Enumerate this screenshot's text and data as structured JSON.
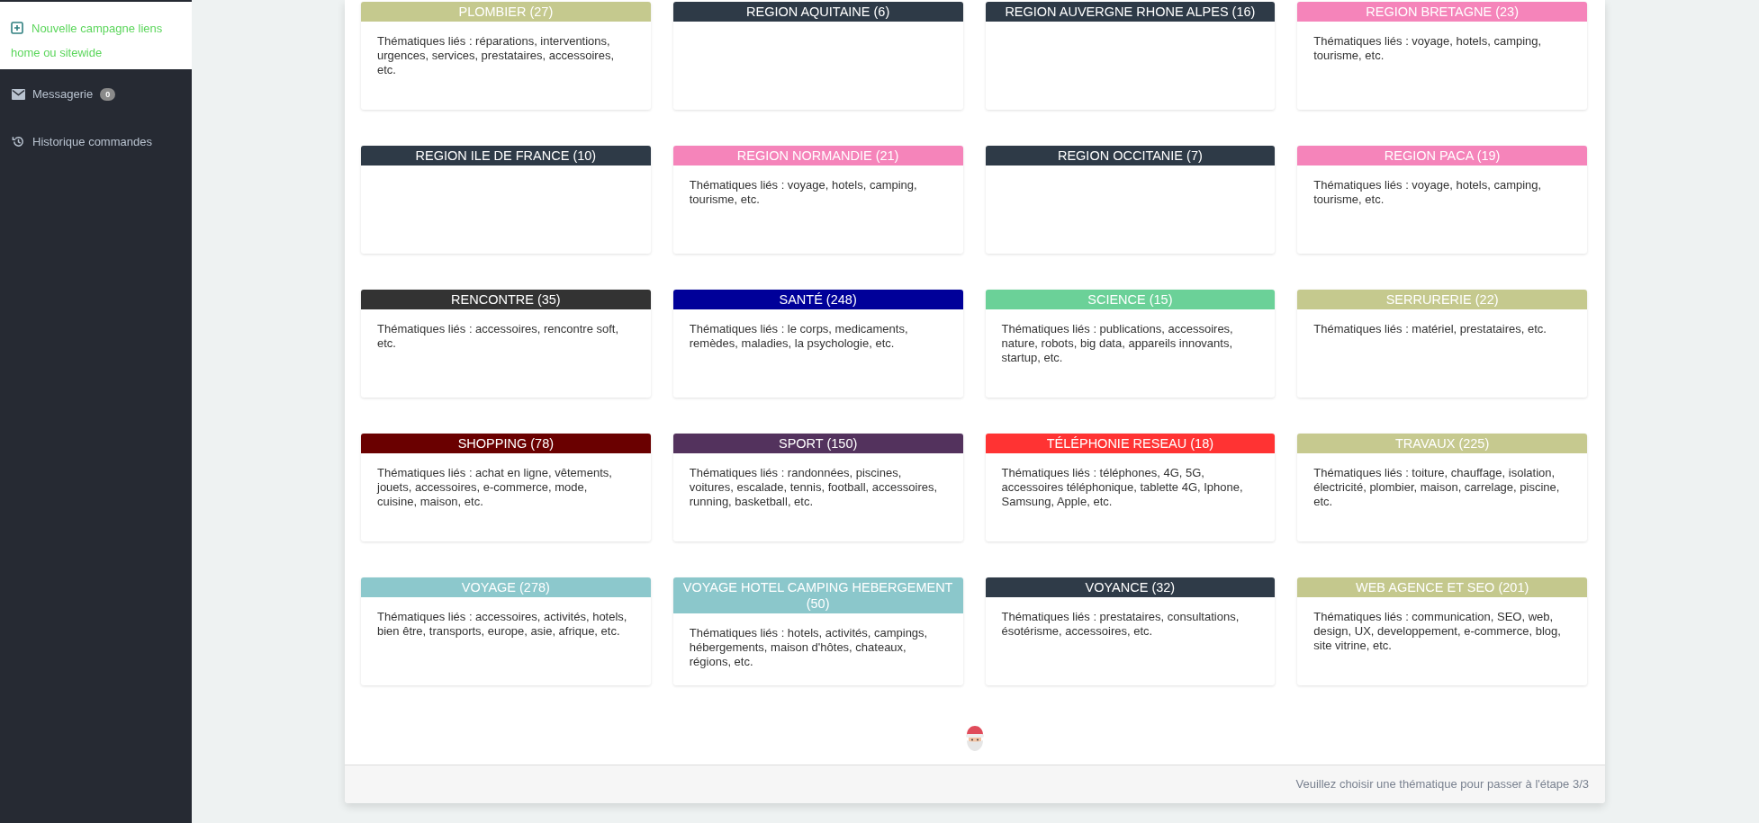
{
  "sidebar": {
    "new_campaign": "Nouvelle campagne liens home ou sitewide",
    "items": [
      {
        "label": "Messagerie",
        "badge": "0",
        "kind": "mail"
      },
      {
        "label": "Historique commandes",
        "kind": "history"
      }
    ]
  },
  "themes": [
    {
      "title": "PLOMBIER (27)",
      "color": "#c5c98e",
      "description": "Thématiques liés : réparations, interventions, urgences, services, prestataires, accessoires, etc."
    },
    {
      "title": "REGION AQUITAINE (6)",
      "color": "#2e3a47"
    },
    {
      "title": "REGION AUVERGNE RHONE ALPES (16)",
      "color": "#2e3a47"
    },
    {
      "title": "REGION BRETAGNE (23)",
      "color": "#f584ba",
      "description": "Thématiques liés : voyage, hotels, camping, tourisme, etc."
    },
    {
      "title": "REGION ILE DE FRANCE (10)",
      "color": "#2e3a47"
    },
    {
      "title": "REGION NORMANDIE (21)",
      "color": "#f584ba",
      "description": "Thématiques liés : voyage, hotels, camping, tourisme, etc."
    },
    {
      "title": "REGION OCCITANIE (7)",
      "color": "#2e3a47"
    },
    {
      "title": "REGION PACA (19)",
      "color": "#f584ba",
      "description": "Thématiques liés : voyage, hotels, camping, tourisme, etc."
    },
    {
      "title": "RENCONTRE (35)",
      "color": "#333333",
      "description": "Thématiques liés : accessoires, rencontre soft, etc."
    },
    {
      "title": "SANTÉ (248)",
      "color": "#000099",
      "description": "Thématiques liés : le corps, medicaments, remèdes, maladies, la psychologie, etc."
    },
    {
      "title": "SCIENCE (15)",
      "color": "#6bd198",
      "description": "Thématiques liés : publications, accessoires, nature, robots, big data, appareils innovants, startup, etc."
    },
    {
      "title": "SERRURERIE (22)",
      "color": "#c5c98e",
      "description": "Thématiques liés : matériel, prestataires, etc."
    },
    {
      "title": "SHOPPING (78)",
      "color": "#6a0000",
      "description": "Thématiques liés : achat en ligne, vêtements, jouets, accessoires, e-commerce, mode, cuisine, maison, etc."
    },
    {
      "title": "SPORT (150)",
      "color": "#53325d",
      "description": "Thématiques liés : randonnées, piscines, voitures, escalade, tennis, football, accessoires, running, basketball, etc."
    },
    {
      "title": "TÉLÉPHONIE RESEAU (18)",
      "color": "#ff3333",
      "description": "Thématiques liés : téléphones, 4G, 5G, accessoires téléphonique, tablette 4G, Iphone, Samsung, Apple, etc."
    },
    {
      "title": "TRAVAUX (225)",
      "color": "#c6c98f",
      "description": "Thématiques liés : toiture, chauffage, isolation, électricité, plombier, maison, carrelage, piscine, etc."
    },
    {
      "title": "VOYAGE (278)",
      "color": "#8cc8cc",
      "description": "Thématiques liés : accessoires, activités, hotels, bien être, transports, europe, asie, afrique, etc."
    },
    {
      "title": "VOYAGE HOTEL CAMPING HEBERGEMENT (50)",
      "color": "#8bc7cb",
      "description": "Thématiques liés : hotels, activités, campings, hébergements, maison d'hôtes, chateaux, régions, etc."
    },
    {
      "title": "VOYANCE (32)",
      "color": "#2f3b48",
      "description": "Thématiques liés : prestataires, consultations, ésotérisme, accessoires, etc."
    },
    {
      "title": "WEB AGENCE ET SEO (201)",
      "color": "#c4c88d",
      "description": "Thématiques liés : communication, SEO, web, design, UX, developpement, e-commerce, blog, site vitrine, etc."
    }
  ],
  "footer": "Veuillez choisir une thématique pour passer à l'étape 3/3"
}
